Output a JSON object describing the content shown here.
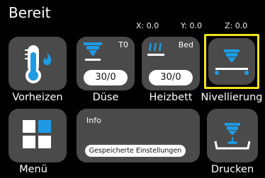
{
  "status": {
    "title": "Bereit",
    "x": "X: 0.0",
    "y": "Y: 0.0",
    "z": "Z: 0.0"
  },
  "tiles": {
    "preheat": {
      "label": "Vorheizen",
      "icon": "thermometer-flame-icon"
    },
    "nozzle": {
      "label": "Düse",
      "tag": "T0",
      "value": "30/0",
      "icon": "nozzle-icon"
    },
    "bed": {
      "label": "Heizbett",
      "tag": "Bed",
      "value": "30/0",
      "icon": "heatbed-icon"
    },
    "leveling": {
      "label": "Nivellierung",
      "icon": "leveling-icon"
    },
    "menu": {
      "label": "Menü",
      "icon": "grid-menu-icon"
    },
    "info": {
      "title": "Info",
      "button": "Gespeicherte Einstellungen"
    },
    "print": {
      "label": "Drucken",
      "icon": "print-icon"
    }
  },
  "colors": {
    "accent": "#1e9be4",
    "tile": "#4a4a4a",
    "selection": "#f0e21b"
  }
}
